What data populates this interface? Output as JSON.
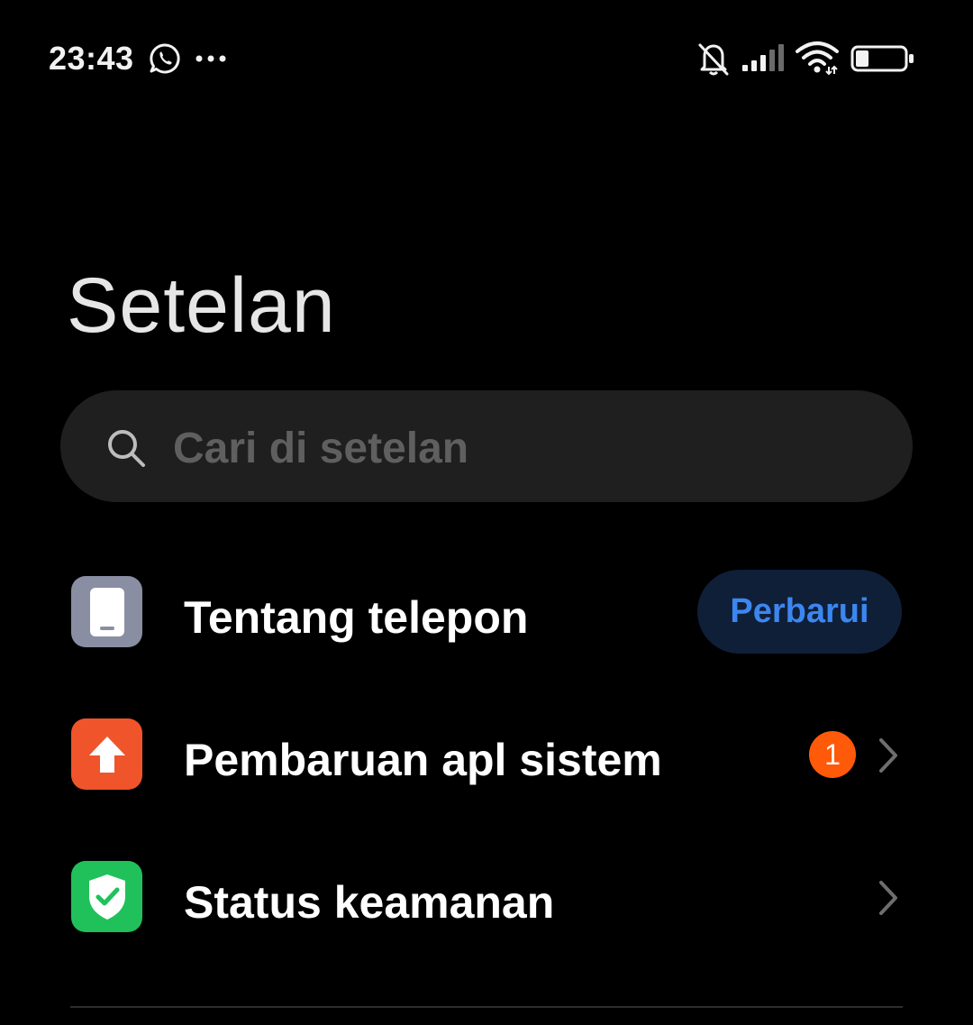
{
  "status_bar": {
    "time": "23:43",
    "battery": "26",
    "icons": [
      "whatsapp-icon",
      "more-dots-icon",
      "bell-muted-icon",
      "signal-icon",
      "wifi-icon",
      "battery-icon"
    ]
  },
  "page": {
    "title": "Setelan"
  },
  "search": {
    "placeholder": "Cari di setelan"
  },
  "items": [
    {
      "label": "Tentang telepon",
      "icon": "phone-icon",
      "icon_color": "#8a8ea3",
      "action_label": "Perbarui"
    },
    {
      "label": "Pembaruan apl sistem",
      "icon": "arrow-up-icon",
      "icon_color": "#f0542a",
      "badge": "1"
    },
    {
      "label": "Status keamanan",
      "icon": "shield-check-icon",
      "icon_color": "#20c15a"
    }
  ],
  "colors": {
    "background": "#000000",
    "search_bg": "#1f1f1f",
    "accent_blue": "#3c86f0",
    "badge_orange": "#ff5a0a"
  }
}
